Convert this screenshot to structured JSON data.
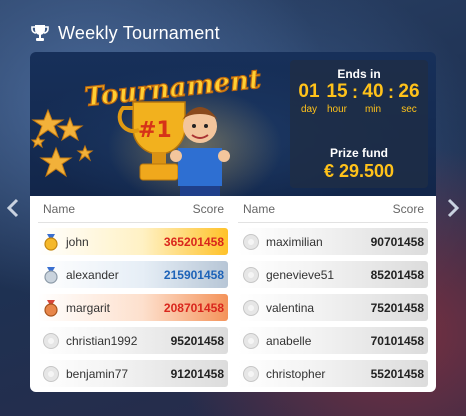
{
  "header": {
    "title": "Weekly Tournament",
    "icon": "trophy-icon"
  },
  "banner": {
    "logo_text": "Tournament",
    "badge_text": "#1",
    "ends_label": "Ends in",
    "countdown": [
      {
        "value": "01",
        "label": "day"
      },
      {
        "value": "15",
        "label": "hour"
      },
      {
        "value": "40",
        "label": "min"
      },
      {
        "value": "26",
        "label": "sec"
      }
    ],
    "prize_label": "Prize fund",
    "prize_value": "€ 29.500"
  },
  "columns": {
    "name_header": "Name",
    "score_header": "Score"
  },
  "leaderboard_left": [
    {
      "name": "john",
      "score": "365201458",
      "medal": "gold"
    },
    {
      "name": "alexander",
      "score": "215901458",
      "medal": "silver"
    },
    {
      "name": "margarit",
      "score": "208701458",
      "medal": "bronze"
    },
    {
      "name": "christian1992",
      "score": "95201458",
      "medal": "none"
    },
    {
      "name": "benjamin77",
      "score": "91201458",
      "medal": "none"
    }
  ],
  "leaderboard_right": [
    {
      "name": "maximilian",
      "score": "90701458",
      "medal": "none"
    },
    {
      "name": "genevieve51",
      "score": "85201458",
      "medal": "none"
    },
    {
      "name": "valentina",
      "score": "75201458",
      "medal": "none"
    },
    {
      "name": "anabelle",
      "score": "70101458",
      "medal": "none"
    },
    {
      "name": "christopher",
      "score": "55201458",
      "medal": "none"
    }
  ],
  "colors": {
    "accent": "#ffc21a",
    "gold": "#ffc229",
    "silver": "#b7c6d6",
    "bronze": "#f4935a",
    "score_red": "#d9261c",
    "score_blue": "#1e63b8"
  },
  "navigation": {
    "prev_icon": "chevron-left-icon",
    "next_icon": "chevron-right-icon"
  }
}
